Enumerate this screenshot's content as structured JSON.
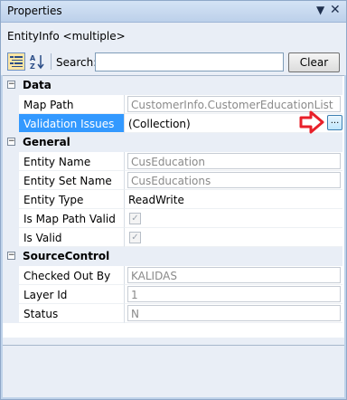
{
  "window": {
    "title": "Properties"
  },
  "object_selector": {
    "label": "EntityInfo <multiple>"
  },
  "toolbar": {
    "search_label": "Search:",
    "search_value": "",
    "clear_label": "Clear",
    "categorized_icon": "categorized-icon",
    "alphabetical_icon": "sort-alphabetical-icon"
  },
  "categories": [
    {
      "label": "Data",
      "expander": "−",
      "properties": [
        {
          "name": "Map Path",
          "value": "CustomerInfo.CustomerEducationList",
          "readonly": true
        },
        {
          "name": "Validation Issues",
          "value": "(Collection)",
          "readonly": false,
          "selected": true,
          "button": "..."
        }
      ]
    },
    {
      "label": "General",
      "expander": "−",
      "properties": [
        {
          "name": "Entity Name",
          "value": "CusEducation",
          "readonly": true
        },
        {
          "name": "Entity Set Name",
          "value": "CusEducations",
          "readonly": true
        },
        {
          "name": "Entity Type",
          "value": "ReadWrite",
          "readonly": false
        },
        {
          "name": "Is Map Path Valid",
          "value": "✓",
          "readonly": true,
          "checkbox": true
        },
        {
          "name": "Is Valid",
          "value": "✓",
          "readonly": true,
          "checkbox": true
        }
      ]
    },
    {
      "label": "SourceControl",
      "expander": "−",
      "properties": [
        {
          "name": "Checked Out By",
          "value": "KALIDAS",
          "readonly": true
        },
        {
          "name": "Layer Id",
          "value": "1",
          "readonly": true
        },
        {
          "name": "Status",
          "value": "N",
          "readonly": true
        }
      ]
    }
  ],
  "colors": {
    "selection": "#3399ff",
    "annotation_arrow": "#e8202a",
    "category_band": "#e9eef6"
  }
}
